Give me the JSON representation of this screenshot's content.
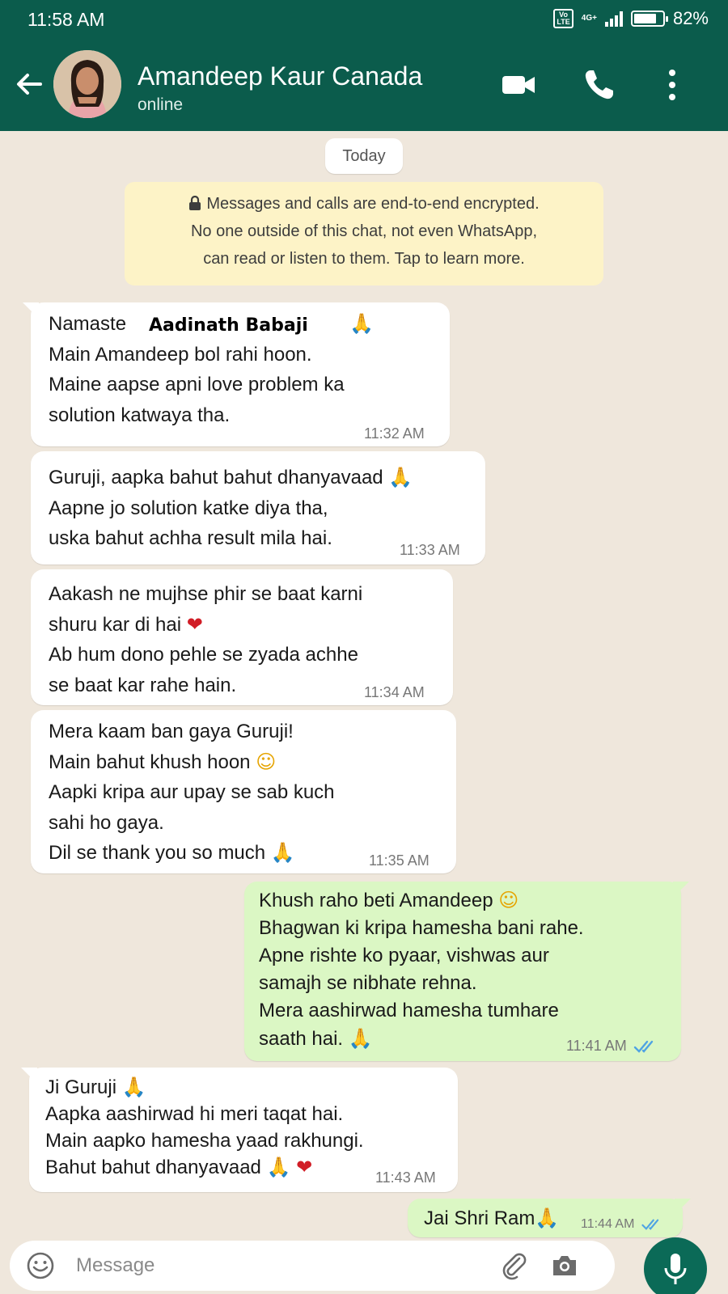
{
  "status_bar": {
    "time": "11:58 AM",
    "volte": "Vo LTE",
    "network": "4G+",
    "battery": "82%"
  },
  "header": {
    "contact_name": "Amandeep Kaur Canada",
    "status": "online"
  },
  "chat": {
    "date_label": "Today",
    "encryption_notice": [
      "Messages and calls are end-to-end encrypted.",
      "No one outside of this chat, not even WhatsApp,",
      "can read or listen to them. Tap to learn more."
    ],
    "overlay_name": "Aadinath Babaji",
    "messages": [
      {
        "direction": "in",
        "lines": [
          "Namaste",
          "Main Amandeep bol rahi hoon.",
          "Maine aapse apni love problem ka",
          "solution katwaya tha."
        ],
        "time": "11:32 AM"
      },
      {
        "direction": "in",
        "lines": [
          "Guruji, aapka bahut bahut dhanyavaad",
          "Aapne jo solution katke diya tha,",
          "uska bahut achha result mila hai."
        ],
        "time": "11:33 AM"
      },
      {
        "direction": "in",
        "lines": [
          "Aakash ne mujhse phir se baat karni",
          "shuru kar di hai",
          "Ab hum dono pehle se zyada achhe",
          "se baat kar rahe hain."
        ],
        "time": "11:34 AM"
      },
      {
        "direction": "in",
        "lines": [
          "Mera kaam ban gaya Guruji!",
          "Main bahut khush hoon",
          "Aapki kripa aur upay se sab kuch",
          "sahi ho gaya.",
          "Dil se thank you so much"
        ],
        "time": "11:35 AM"
      },
      {
        "direction": "out",
        "lines": [
          "Khush raho beti Amandeep",
          "Bhagwan ki kripa hamesha bani rahe.",
          "Apne rishte ko pyaar, vishwas aur",
          "samajh se nibhate rehna.",
          "Mera aashirwad hamesha tumhare",
          "saath hai."
        ],
        "time": "11:41 AM",
        "read": true
      },
      {
        "direction": "in",
        "lines": [
          "Ji Guruji",
          "Aapka aashirwad hi meri taqat hai.",
          "Main aapko hamesha yaad rakhungi.",
          "Bahut bahut dhanyavaad"
        ],
        "time": "11:43 AM"
      },
      {
        "direction": "out",
        "lines": [
          "Jai Shri Ram"
        ],
        "time": "11:44 AM",
        "read": true
      }
    ],
    "emojis": {
      "pray": "🙏",
      "heart": "❤",
      "smile": "☺"
    }
  },
  "input": {
    "placeholder": "Message"
  },
  "colors": {
    "header_bg": "#0b5c4c",
    "chat_bg": "#efe7dc",
    "outgoing_bubble": "#dbf7c4",
    "incoming_bubble": "#ffffff",
    "read_ticks": "#4fa3e3",
    "mic_button": "#0b6a57"
  },
  "icons": [
    "back-arrow-icon",
    "video-call-icon",
    "phone-call-icon",
    "more-options-icon",
    "emoji-icon",
    "attach-icon",
    "camera-icon",
    "mic-icon",
    "lock-icon",
    "double-check-icon"
  ]
}
